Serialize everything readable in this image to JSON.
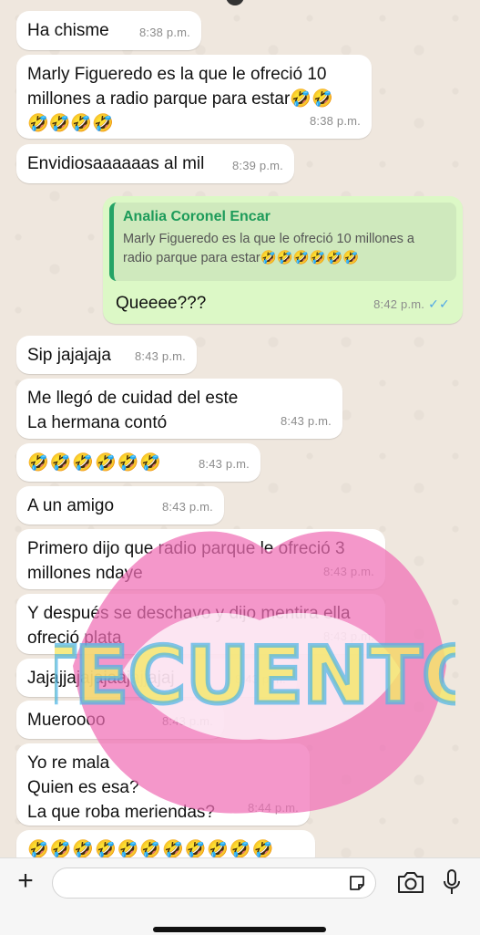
{
  "messages": [
    {
      "text": "Ha chisme",
      "time": "8:38 p.m."
    },
    {
      "text": "Marly Figueredo es la que le ofreció 10\nmillones a radio parque para estar🤣🤣\n🤣🤣🤣🤣",
      "time": "8:38 p.m."
    },
    {
      "text": "Envidiosaaaaaas al mil",
      "time": "8:39 p.m."
    },
    {
      "quote_name": "Analia Coronel Encar",
      "quote_text": "Marly Figueredo es la que le ofreció 10 millones a\nradio parque para estar🤣🤣🤣🤣🤣🤣",
      "text": "Queeee???",
      "time": "8:42 p.m."
    },
    {
      "text": "Sip jajajaja",
      "time": "8:43 p.m."
    },
    {
      "text": "Me llegó de cuidad del este\nLa hermana contó",
      "time": "8:43 p.m."
    },
    {
      "text": "🤣🤣🤣🤣🤣🤣",
      "time": "8:43 p.m."
    },
    {
      "text": "A un amigo",
      "time": "8:43 p.m."
    },
    {
      "text": "Primero dijo que radio parque le ofreció 3\nmillones ndaye",
      "time": "8:43 p.m."
    },
    {
      "text": "Y después se deschavo y dijo mentira ella\nofreció plata",
      "time": "8:43 p.m."
    },
    {
      "text": "Jajajjajajajaajajjajaj",
      "time": "8:43 p.m."
    },
    {
      "text": "Mueroooo",
      "time": "8:43 p.m."
    },
    {
      "text": "Yo re mala\nQuien es esa?\nLa que roba meriendas?",
      "time": "8:44 p.m."
    },
    {
      "text": "🤣🤣🤣🤣🤣🤣🤣🤣🤣🤣🤣"
    }
  ],
  "watermark": {
    "text": "TECUENTO"
  },
  "colors": {
    "incoming": "#ffffff",
    "outgoing": "#dcf8c6",
    "quote_bar": "#25a366",
    "read_ticks": "#4fa6e6"
  },
  "icons": [
    "plus-icon",
    "sticker-icon",
    "camera-icon",
    "microphone-icon"
  ]
}
